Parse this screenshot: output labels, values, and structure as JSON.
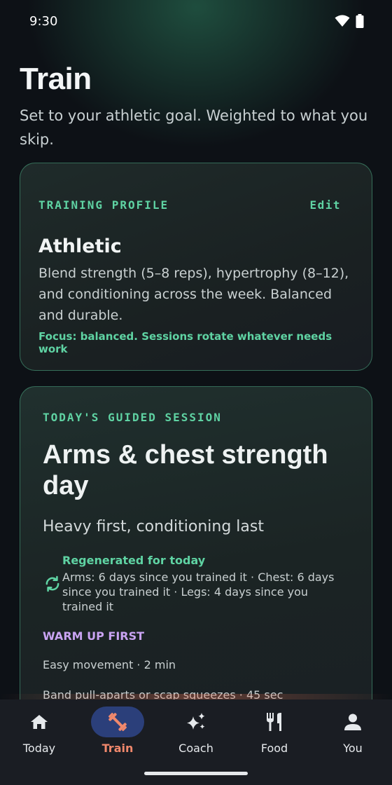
{
  "status_bar": {
    "time": "9:30"
  },
  "header": {
    "title": "Train",
    "subtitle": "Set to your athletic goal. Weighted to what you skip."
  },
  "profile_card": {
    "eyebrow": "TRAINING PROFILE",
    "edit_label": "Edit",
    "name": "Athletic",
    "description": "Blend strength (5–8 reps), hypertrophy (8–12), and conditioning across the week. Balanced and durable.",
    "focus": "Focus: balanced. Sessions rotate whatever needs work"
  },
  "session_card": {
    "eyebrow": "TODAY'S GUIDED SESSION",
    "title": "Arms & chest strength day",
    "subtitle": "Heavy first, conditioning last",
    "regen_title": "Regenerated for today",
    "regen_text": "Arms: 6 days since you trained it · Chest: 6 days since you trained it · Legs: 4 days since you trained it",
    "warmup_label": "WARM UP FIRST",
    "steps": [
      "Easy movement · 2 min",
      "Band pull-aparts or scap squeezes · 45 sec"
    ]
  },
  "bottom_nav": {
    "items": [
      {
        "label": "Today",
        "icon": "home-icon"
      },
      {
        "label": "Train",
        "icon": "dumbbell-icon"
      },
      {
        "label": "Coach",
        "icon": "sparkle-icon"
      },
      {
        "label": "Food",
        "icon": "utensils-icon"
      },
      {
        "label": "You",
        "icon": "person-icon"
      }
    ],
    "active": "Train"
  },
  "colors": {
    "accent": "#5fd3a3",
    "warmup": "#c9a3f2",
    "active_nav": "#f0886c",
    "active_pill": "#2b3f7a"
  }
}
